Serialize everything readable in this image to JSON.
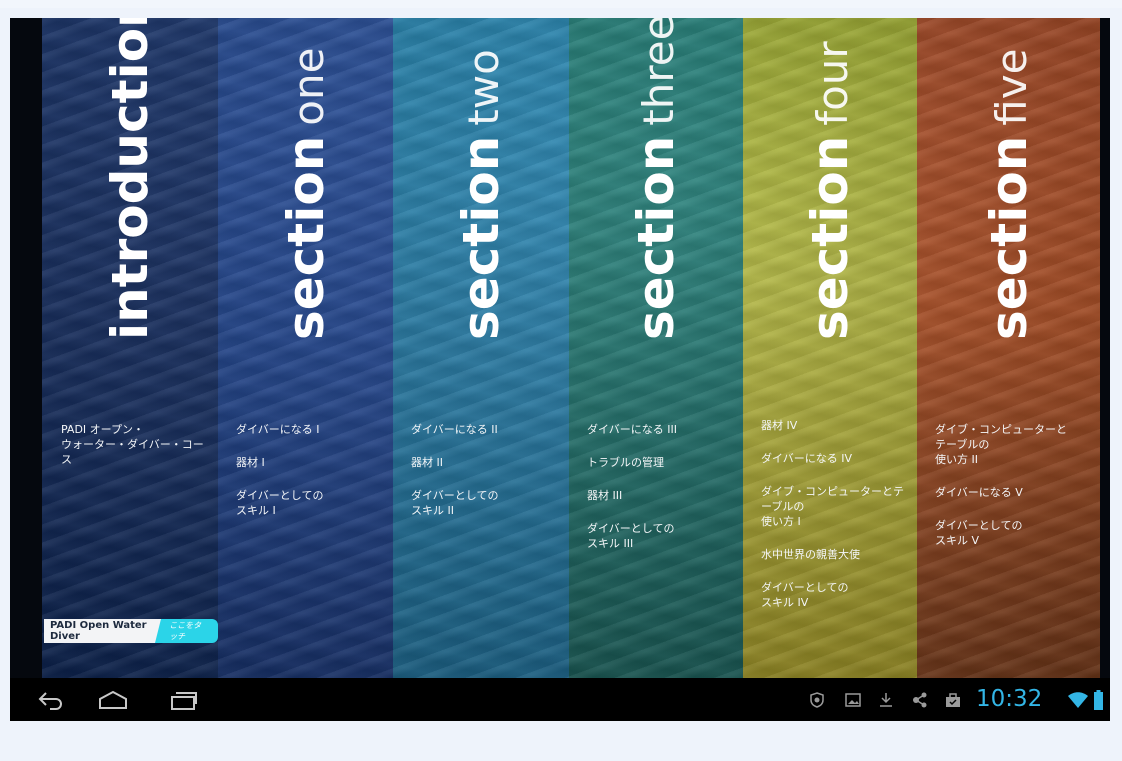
{
  "app": {
    "columns": [
      {
        "id": "introduction",
        "title_bold": "introduction",
        "title_light": "",
        "items": [
          "PADI オープン・\nウォーター・ダイバー・コース"
        ]
      },
      {
        "id": "section-one",
        "title_bold": "section",
        "title_light": "one",
        "items": [
          "ダイバーになる I",
          "器材 I",
          "ダイバーとしての\nスキル I"
        ]
      },
      {
        "id": "section-two",
        "title_bold": "section",
        "title_light": "two",
        "items": [
          "ダイバーになる II",
          "器材 II",
          "ダイバーとしての\nスキル II"
        ]
      },
      {
        "id": "section-three",
        "title_bold": "section",
        "title_light": "three",
        "items": [
          "ダイバーになる III",
          "トラブルの管理",
          "器材 III",
          "ダイバーとしての\nスキル III"
        ]
      },
      {
        "id": "section-four",
        "title_bold": "section",
        "title_light": "four",
        "items": [
          "器材 IV",
          "ダイバーになる IV",
          "ダイブ・コンピューターとテ\nーブルの\n使い方 I",
          "水中世界の親善大使",
          "ダイバーとしての\nスキル IV"
        ]
      },
      {
        "id": "section-five",
        "title_bold": "section",
        "title_light": "five",
        "items": [
          "ダイブ・コンピューターと\nテーブルの\n使い方 II",
          "ダイバーになる V",
          "ダイバーとしての\nスキル V"
        ]
      }
    ],
    "bottom_label": {
      "name": "PADI Open Water Diver",
      "touch": "ここをタッチ"
    }
  },
  "status_bar": {
    "time": "10:32",
    "icons": [
      "shield-icon",
      "image-icon",
      "download-icon",
      "share-icon",
      "briefcase-icon",
      "wifi-icon",
      "battery-icon"
    ]
  },
  "nav_bar": {
    "icons": [
      "back-icon",
      "home-icon",
      "recent-apps-icon"
    ]
  },
  "colors": {
    "introduction": "#15306a",
    "section_one": "#1d4596",
    "section_two": "#1e7aa8",
    "section_three": "#18726c",
    "section_four": "#b3b83a",
    "section_five": "#b04b1d",
    "clock": "#33b5e5",
    "touch_button": "#2bd4e8"
  }
}
